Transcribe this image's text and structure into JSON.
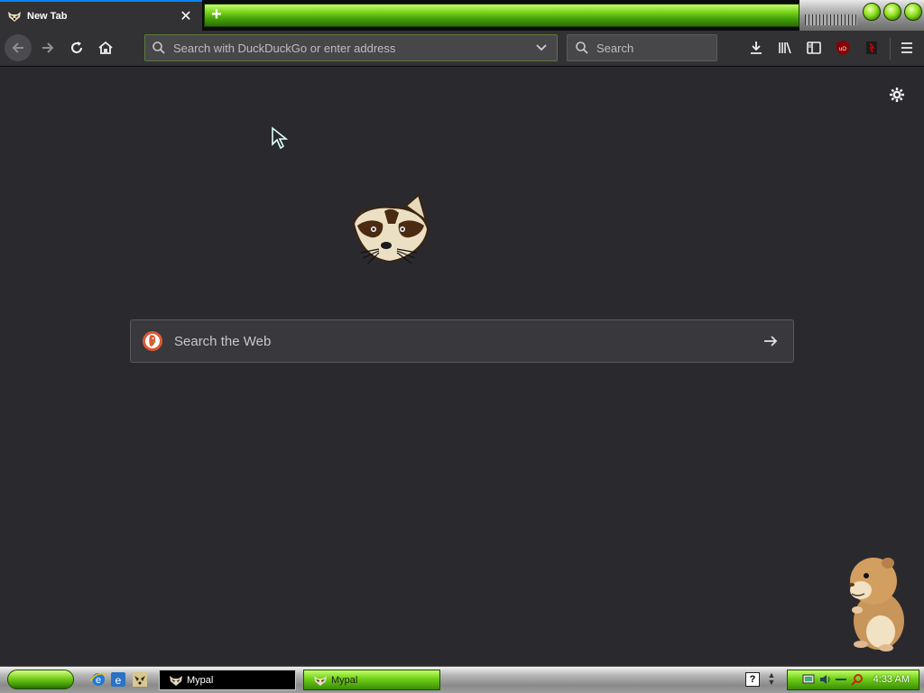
{
  "browser": {
    "active_tab": {
      "title": "New Tab",
      "favicon": "raccoon-icon",
      "close_icon": "close-icon"
    },
    "new_tab_icon": "plus-icon",
    "urlbar": {
      "placeholder": "Search with DuckDuckGo or enter address",
      "icon": "search-icon",
      "dropdown_icon": "chevron-down-icon"
    },
    "searchbar": {
      "placeholder": "Search",
      "icon": "search-icon"
    },
    "toolbar_icons": [
      "back-arrow-icon",
      "forward-arrow-icon",
      "reload-icon",
      "home-icon",
      "download-icon",
      "library-icon",
      "sidebar-icon",
      "ublock-icon",
      "addon-icon",
      "hamburger-menu-icon"
    ]
  },
  "newtab": {
    "settings_icon": "gear-icon",
    "logo": "raccoon-logo",
    "search": {
      "placeholder": "Search the Web",
      "engine_icon": "duckduckgo-icon",
      "submit_icon": "arrow-right-icon"
    }
  },
  "taskbar": {
    "tasks": [
      {
        "label": "Mypal",
        "state": "active"
      },
      {
        "label": "Mypal",
        "state": "normal"
      }
    ],
    "clock": "4:33 AM"
  },
  "colors": {
    "content_bg": "#2a2a2e",
    "toolbar_bg": "#323234",
    "accent_green": "#7ed321",
    "tab_highlight": "#0a84ff"
  }
}
